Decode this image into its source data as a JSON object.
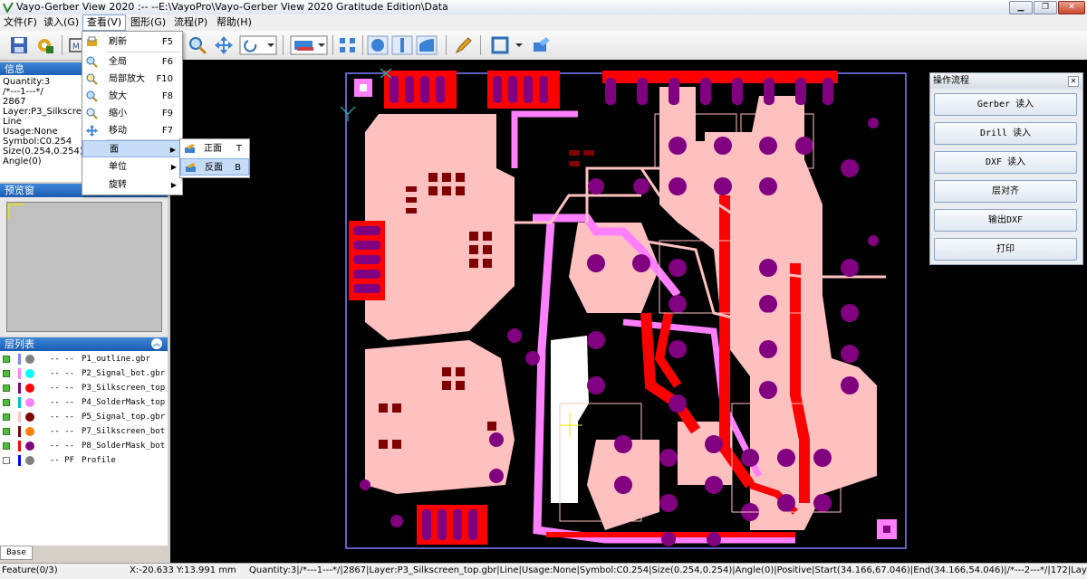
{
  "window": {
    "title": "Vayo-Gerber View 2020 :-- --E:\\VayoPro\\Vayo-Gerber View 2020 Gratitude Edition\\Data"
  },
  "menubar": [
    "文件(F)",
    "读入(G)",
    "查看(V)",
    "图形(G)",
    "流程(P)",
    "帮助(H)"
  ],
  "view_menu": {
    "items": [
      {
        "label": "刷新",
        "shortcut": "F5",
        "icon": "refresh-icon"
      },
      {
        "label": "全局",
        "shortcut": "F6",
        "icon": "zoom-all-icon"
      },
      {
        "label": "局部放大",
        "shortcut": "F10",
        "icon": "zoom-area-icon"
      },
      {
        "label": "放大",
        "shortcut": "F8",
        "icon": "zoom-in-icon"
      },
      {
        "label": "缩小",
        "shortcut": "F9",
        "icon": "zoom-out-icon"
      },
      {
        "label": "移动",
        "shortcut": "F7",
        "icon": "move-icon"
      },
      {
        "label": "面",
        "submenu": true
      },
      {
        "label": "单位",
        "submenu": true
      },
      {
        "label": "旋转",
        "submenu": true
      }
    ],
    "submenu": [
      {
        "label": "正面",
        "shortcut": "T"
      },
      {
        "label": "反面",
        "shortcut": "B"
      }
    ]
  },
  "info_panel": {
    "title": "信息",
    "lines": [
      "Quantity:3",
      "/*---1---*/",
      "2867",
      "Layer:P3_Silkscreen",
      "Line",
      "Usage:None",
      "Symbol:C0.254",
      "Size(0.254,0.254)",
      "Angle(0)"
    ]
  },
  "preview_panel": {
    "title": "预览窗"
  },
  "layer_panel": {
    "title": "层列表",
    "layers": [
      {
        "dash": "-- --",
        "name": "P1_outline.gbr",
        "bar": "#8080ff",
        "dot": "#808080",
        "checked": true
      },
      {
        "dash": "-- --",
        "name": "P2_Signal_bot.gbr",
        "bar": "#ff80ff",
        "dot": "#00ffff",
        "checked": true
      },
      {
        "dash": "-- --",
        "name": "P3_Silkscreen_top",
        "bar": "#800080",
        "dot": "#ff0000",
        "checked": true
      },
      {
        "dash": "-- --",
        "name": "P4_SolderMask_top",
        "bar": "#00c0c0",
        "dot": "#ff80ff",
        "checked": true
      },
      {
        "dash": "-- --",
        "name": "P5_Signal_top.gbr",
        "bar": "#ffc0c0",
        "dot": "#800000",
        "checked": true
      },
      {
        "dash": "-- --",
        "name": "P7_Silkscreen_bot",
        "bar": "#800000",
        "dot": "#ff8000",
        "checked": true
      },
      {
        "dash": "-- --",
        "name": "P8_SolderMask_bot",
        "bar": "#ff0000",
        "dot": "#800080",
        "checked": true
      },
      {
        "dash": "-- PF",
        "name": "Profile",
        "bar": "#0000ff",
        "dot": "#808080",
        "checked": false
      }
    ],
    "tab": "Base"
  },
  "flow_panel": {
    "title": "操作流程",
    "buttons": [
      "Gerber 读入",
      "Drill 读入",
      "DXF 读入",
      "层对齐",
      "输出DXF",
      "打印"
    ]
  },
  "statusbar": {
    "feature": "Feature(0/3)",
    "coords": "X:-20.633 Y:13.991 mm",
    "detail": "Quantity:3|/*---1---*/|2867|Layer:P3_Silkscreen_top.gbr|Line|Usage:None|Symbol:C0.254|Size(0.254,0.254)|Angle(0)|Positive|Start(34.166,67.046)|End(34.166,54.046)|/*---2---*/|172|Layer"
  },
  "colors": {
    "pad": "#800080",
    "copper": "#ffc0c0",
    "trace": "#ff0000",
    "mask": "#ff80ff",
    "outline": "#8080ff"
  }
}
